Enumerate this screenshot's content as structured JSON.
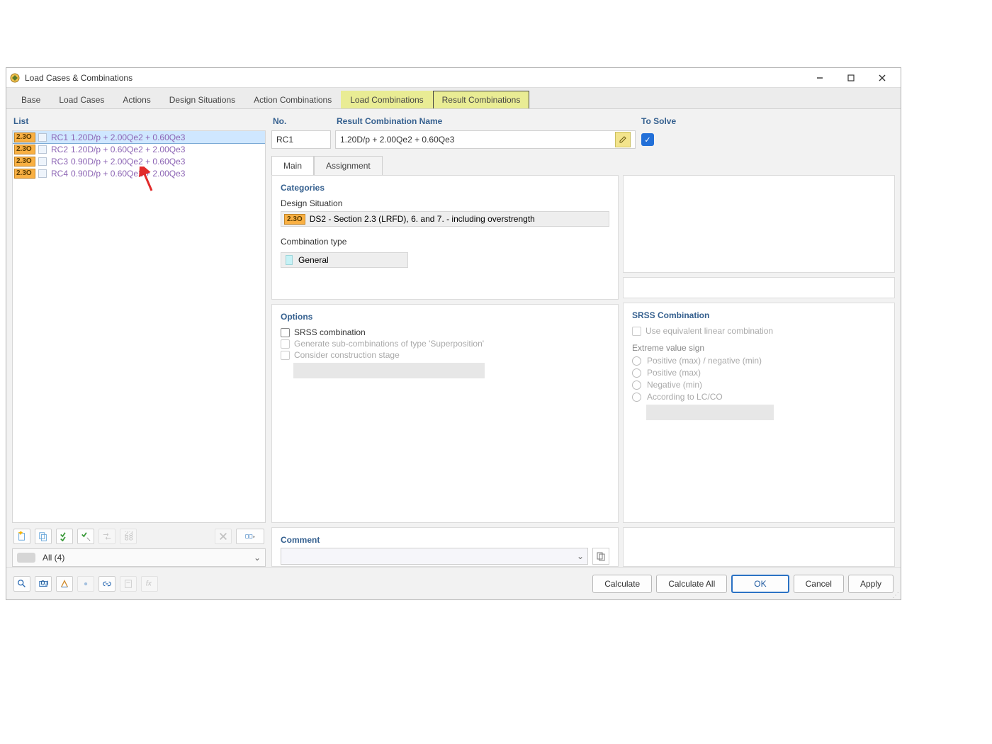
{
  "window": {
    "title": "Load Cases & Combinations"
  },
  "tabs": {
    "base": "Base",
    "loadcases": "Load Cases",
    "actions": "Actions",
    "designsit": "Design Situations",
    "actioncomb": "Action Combinations",
    "loadcomb": "Load Combinations",
    "resultcomb": "Result Combinations"
  },
  "list": {
    "heading": "List",
    "rows": [
      {
        "tag": "2.3O",
        "rc": "RC1",
        "expr": "1.20D/p + 2.00Qe2 + 0.60Qe3"
      },
      {
        "tag": "2.3O",
        "rc": "RC2",
        "expr": "1.20D/p + 0.60Qe2 + 2.00Qe3"
      },
      {
        "tag": "2.3O",
        "rc": "RC3",
        "expr": "0.90D/p + 2.00Qe2 + 0.60Qe3"
      },
      {
        "tag": "2.3O",
        "rc": "RC4",
        "expr": "0.90D/p + 0.60Qe2 + 2.00Qe3"
      }
    ],
    "filter": "All (4)"
  },
  "form": {
    "no_label": "No.",
    "no_value": "RC1",
    "name_label": "Result Combination Name",
    "name_value": "1.20D/p + 2.00Qe2 + 0.60Qe3",
    "solve_label": "To Solve"
  },
  "pagetabs": {
    "main": "Main",
    "assign": "Assignment"
  },
  "categories": {
    "title": "Categories",
    "design_label": "Design Situation",
    "design_tag": "2.3O",
    "design_value": "DS2 - Section 2.3 (LRFD), 6. and 7. - including overstrength",
    "ctype_label": "Combination type",
    "ctype_value": "General"
  },
  "options": {
    "title": "Options",
    "srss": "SRSS combination",
    "gensub": "Generate sub-combinations of type 'Superposition'",
    "construct": "Consider construction stage"
  },
  "srss": {
    "title": "SRSS Combination",
    "equivalent": "Use equivalent linear combination",
    "extreme_label": "Extreme value sign",
    "r1": "Positive (max) / negative (min)",
    "r2": "Positive (max)",
    "r3": "Negative (min)",
    "r4": "According to LC/CO"
  },
  "comment": {
    "title": "Comment"
  },
  "buttons": {
    "calculate": "Calculate",
    "calc_all": "Calculate All",
    "ok": "OK",
    "cancel": "Cancel",
    "apply": "Apply"
  }
}
